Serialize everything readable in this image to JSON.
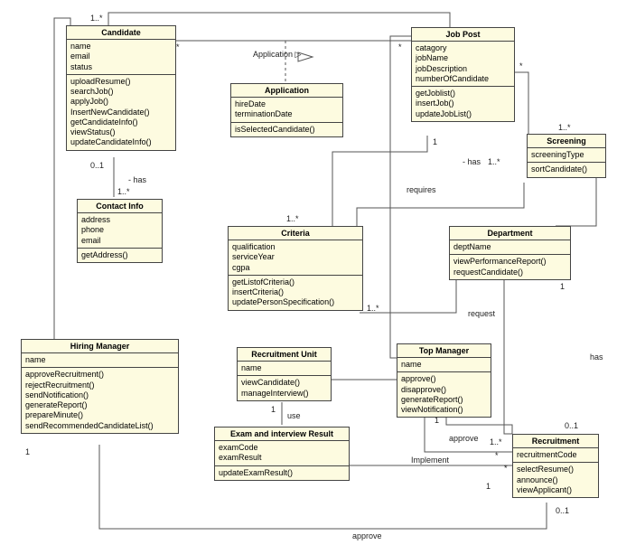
{
  "classes": {
    "candidate": {
      "title": "Candidate",
      "attrs": [
        "name",
        "email",
        "status"
      ],
      "ops": [
        "uploadResume()",
        "searchJob()",
        "applyJob()",
        "InsertNewCandidate()",
        "getCandidateInfo()",
        "viewStatus()",
        "updateCandidateInfo()"
      ]
    },
    "jobpost": {
      "title": "Job Post",
      "attrs": [
        "catagory",
        "jobName",
        "jobDescription",
        "numberOfCandidate"
      ],
      "ops": [
        "getJoblist()",
        "insertJob()",
        "updateJobList()"
      ]
    },
    "application": {
      "title": "Application",
      "attrs": [
        "hireDate",
        "terminationDate"
      ],
      "ops": [
        "isSelectedCandidate()"
      ]
    },
    "screening": {
      "title": "Screening",
      "attrs": [
        "screeningType"
      ],
      "ops": [
        "sortCandidate()"
      ]
    },
    "contactinfo": {
      "title": "Contact Info",
      "attrs": [
        "address",
        "phone",
        "email"
      ],
      "ops": [
        "getAddress()"
      ]
    },
    "criteria": {
      "title": "Criteria",
      "attrs": [
        "qualification",
        "serviceYear",
        "cgpa"
      ],
      "ops": [
        "getListofCriteria()",
        "insertCriteria()",
        "updatePersonSpecification()"
      ]
    },
    "department": {
      "title": "Department",
      "attrs": [
        "deptName"
      ],
      "ops": [
        "viewPerformanceReport()",
        "requestCandidate()"
      ]
    },
    "hiringmanager": {
      "title": "Hiring Manager",
      "attrs": [
        "name"
      ],
      "ops": [
        "approveRecruitment()",
        "rejectRecruitment()",
        "sendNotification()",
        "generateReport()",
        "prepareMinute()",
        "sendRecommendedCandidateList()"
      ]
    },
    "recruitmentunit": {
      "title": "Recruitment Unit",
      "attrs": [
        "name"
      ],
      "ops": [
        "viewCandidate()",
        "manageInterview()"
      ]
    },
    "topmanager": {
      "title": "Top Manager",
      "attrs": [
        "name"
      ],
      "ops": [
        "approve()",
        "disapprove()",
        "generateReport()",
        "viewNotification()"
      ]
    },
    "examresult": {
      "title": "Exam and interview Result",
      "attrs": [
        "examCode",
        "examResult"
      ],
      "ops": [
        "updateExamResult()"
      ]
    },
    "recruitment": {
      "title": "Recruitment",
      "attrs": [
        "recruitmentCode"
      ],
      "ops": [
        "selectResume()",
        "announce()",
        "viewApplicant()"
      ]
    }
  },
  "labels": {
    "application_arrow": "Application",
    "has1": "- has",
    "has2": "- has",
    "has3": "has",
    "requires": "requires",
    "request": "request",
    "use": "use",
    "approve1": "approve",
    "approve2": "approve",
    "implement": "Implement"
  },
  "mult": {
    "m1": "1..*",
    "m2": "*",
    "m3": "*",
    "m4": "*",
    "m5": "1..*",
    "m6": "1",
    "m7": "0..1",
    "m8": "1..*",
    "m9": "1..*",
    "m10": "1..*",
    "m11": "1..*",
    "m12": "1",
    "m13": "1..*",
    "m14": "1",
    "m15": "1",
    "m16": "1",
    "m17": "*",
    "m18": "1..*",
    "m19": "*",
    "m20": "0..1",
    "m21": "0..1",
    "m22": "1",
    "m23": "1"
  },
  "chart_data": {
    "type": "uml-class-diagram",
    "classes": [
      {
        "name": "Candidate",
        "attributes": [
          "name",
          "email",
          "status"
        ],
        "methods": [
          "uploadResume()",
          "searchJob()",
          "applyJob()",
          "InsertNewCandidate()",
          "getCandidateInfo()",
          "viewStatus()",
          "updateCandidateInfo()"
        ]
      },
      {
        "name": "Job Post",
        "attributes": [
          "catagory",
          "jobName",
          "jobDescription",
          "numberOfCandidate"
        ],
        "methods": [
          "getJoblist()",
          "insertJob()",
          "updateJobList()"
        ]
      },
      {
        "name": "Application",
        "attributes": [
          "hireDate",
          "terminationDate"
        ],
        "methods": [
          "isSelectedCandidate()"
        ]
      },
      {
        "name": "Screening",
        "attributes": [
          "screeningType"
        ],
        "methods": [
          "sortCandidate()"
        ]
      },
      {
        "name": "Contact Info",
        "attributes": [
          "address",
          "phone",
          "email"
        ],
        "methods": [
          "getAddress()"
        ]
      },
      {
        "name": "Criteria",
        "attributes": [
          "qualification",
          "serviceYear",
          "cgpa"
        ],
        "methods": [
          "getListofCriteria()",
          "insertCriteria()",
          "updatePersonSpecification()"
        ]
      },
      {
        "name": "Department",
        "attributes": [
          "deptName"
        ],
        "methods": [
          "viewPerformanceReport()",
          "requestCandidate()"
        ]
      },
      {
        "name": "Hiring Manager",
        "attributes": [
          "name"
        ],
        "methods": [
          "approveRecruitment()",
          "rejectRecruitment()",
          "sendNotification()",
          "generateReport()",
          "prepareMinute()",
          "sendRecommendedCandidateList()"
        ]
      },
      {
        "name": "Recruitment Unit",
        "attributes": [
          "name"
        ],
        "methods": [
          "viewCandidate()",
          "manageInterview()"
        ]
      },
      {
        "name": "Top Manager",
        "attributes": [
          "name"
        ],
        "methods": [
          "approve()",
          "disapprove()",
          "generateReport()",
          "viewNotification()"
        ]
      },
      {
        "name": "Exam and interview Result",
        "attributes": [
          "examCode",
          "examResult"
        ],
        "methods": [
          "updateExamResult()"
        ]
      },
      {
        "name": "Recruitment",
        "attributes": [
          "recruitmentCode"
        ],
        "methods": [
          "selectResume()",
          "announce()",
          "viewApplicant()"
        ]
      }
    ],
    "relationships": [
      {
        "from": "Candidate",
        "to": "Job Post",
        "via": "Application",
        "type": "association-class",
        "mult": {
          "from": "*",
          "to": "*"
        }
      },
      {
        "from": "Candidate",
        "to": "Contact Info",
        "label": "has",
        "mult": {
          "from": "0..1",
          "to": "1..*"
        }
      },
      {
        "from": "Job Post",
        "to": "Screening",
        "label": "has",
        "mult": {
          "from": "1",
          "to": "1..*"
        }
      },
      {
        "from": "Job Post",
        "to": "Criteria",
        "label": "requires",
        "mult": {
          "to": "1..*"
        }
      },
      {
        "from": "Screening",
        "to": "Criteria",
        "mult": {
          "to": "1..*"
        }
      },
      {
        "from": "Department",
        "to": "Recruitment",
        "label": "request",
        "mult": {
          "from": "1..*",
          "to": "1..*"
        }
      },
      {
        "from": "Department",
        "to": "Screening",
        "label": "has"
      },
      {
        "from": "Recruitment Unit",
        "to": "Exam and interview Result",
        "label": "use",
        "mult": {
          "from": "1"
        }
      },
      {
        "from": "Recruitment Unit",
        "to": "Recruitment",
        "label": "Implement",
        "mult": {
          "from": "1",
          "to": "*"
        }
      },
      {
        "from": "Top Manager",
        "to": "Recruitment",
        "label": "approve",
        "mult": {
          "from": "1",
          "to": "1..*"
        }
      },
      {
        "from": "Hiring Manager",
        "to": "Recruitment",
        "label": "approve",
        "mult": {
          "from": "1",
          "to": "0..1"
        }
      },
      {
        "from": "Hiring Manager",
        "to": "Candidate",
        "mult": {
          "from": "1",
          "to": "1..*"
        }
      },
      {
        "from": "Top Manager",
        "to": "Job Post",
        "mult": {
          "from": "1",
          "to": "*"
        }
      },
      {
        "from": "Exam and interview Result",
        "to": "Recruitment",
        "mult": {
          "to": "0..1"
        }
      }
    ]
  }
}
